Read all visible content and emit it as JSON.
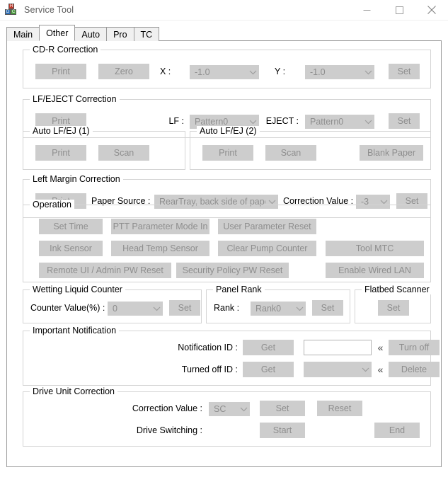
{
  "window": {
    "title": "Service Tool",
    "icon": "app-blocks-icon",
    "controls": {
      "minimize": "minimize-icon",
      "maximize": "maximize-icon",
      "close": "close-icon"
    }
  },
  "tabs": [
    {
      "label": "Main",
      "active": false
    },
    {
      "label": "Other",
      "active": true
    },
    {
      "label": "Auto",
      "active": false
    },
    {
      "label": "Pro",
      "active": false
    },
    {
      "label": "TC",
      "active": false
    }
  ],
  "groups": {
    "cdr": {
      "legend": "CD-R Correction",
      "print": "Print",
      "zero": "Zero",
      "x_label": "X :",
      "x_value": "-1.0",
      "y_label": "Y :",
      "y_value": "-1.0",
      "set": "Set"
    },
    "lfeject": {
      "legend": "LF/EJECT Correction",
      "print": "Print",
      "lf_label": "LF :",
      "lf_value": "Pattern0",
      "eject_label": "EJECT :",
      "eject_value": "Pattern0",
      "set": "Set"
    },
    "autolfej1": {
      "legend": "Auto LF/EJ (1)",
      "print": "Print",
      "scan": "Scan"
    },
    "autolfej2": {
      "legend": "Auto LF/EJ (2)",
      "print": "Print",
      "scan": "Scan",
      "blank_paper": "Blank Paper"
    },
    "leftmargin": {
      "legend": "Left Margin Correction",
      "print": "Print",
      "paper_source_label": "Paper Source :",
      "paper_source_value": "RearTray, back side of paper",
      "correction_label": "Correction Value :",
      "correction_value": "-3",
      "set": "Set"
    },
    "operation": {
      "legend": "Operation",
      "buttons": [
        "Set Time",
        "PTT Parameter Mode In",
        "User Parameter Reset",
        "Ink Sensor",
        "Head Temp Sensor",
        "Clear Pump Counter",
        "Tool MTC",
        "Remote UI / Admin PW Reset",
        "Security Policy PW Reset",
        "Enable Wired LAN"
      ]
    },
    "wetting": {
      "legend": "Wetting Liquid Counter",
      "counter_label": "Counter Value(%) :",
      "counter_value": "0",
      "set": "Set"
    },
    "panelrank": {
      "legend": "Panel Rank",
      "rank_label": "Rank :",
      "rank_value": "Rank0",
      "set": "Set"
    },
    "flatbed": {
      "legend": "Flatbed Scanner",
      "set": "Set"
    },
    "notification": {
      "legend": "Important Notification",
      "notification_id_label": "Notification ID :",
      "notification_get": "Get",
      "notification_id_value": "",
      "notification_chev": "«",
      "turn_off": "Turn off",
      "turned_off_id_label": "Turned off ID :",
      "turned_off_get": "Get",
      "turned_off_id_value": "",
      "turned_off_chev": "«",
      "delete": "Delete"
    },
    "driveunit": {
      "legend": "Drive Unit Correction",
      "correction_label": "Correction Value :",
      "correction_value": "SC",
      "set": "Set",
      "reset": "Reset",
      "drive_switching_label": "Drive Switching :",
      "start": "Start",
      "end": "End"
    }
  },
  "colors": {
    "window_bg": "#ffffff",
    "button_face": "#cdcdcd",
    "disabled_text": "#8e8e8e",
    "group_border": "#d4d4d4",
    "tab_border": "#9a9a9a"
  }
}
